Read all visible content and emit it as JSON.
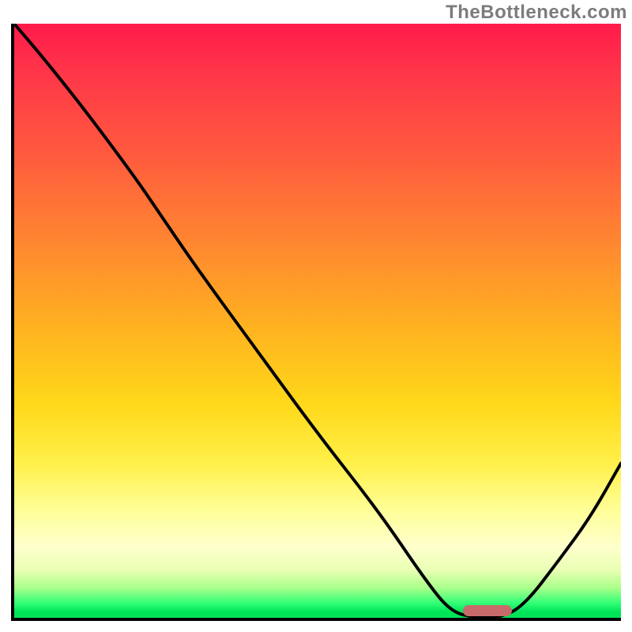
{
  "watermark": "TheBottleneck.com",
  "colors": {
    "gradient_top": "#ff1a4b",
    "gradient_mid1": "#ff8a2f",
    "gradient_mid2": "#ffd81a",
    "gradient_pale": "#ffffcc",
    "gradient_bottom": "#00e558",
    "curve": "#000000",
    "axis": "#000000",
    "marker": "#c96a6a",
    "watermark": "#7c7c7c"
  },
  "chart_data": {
    "type": "line",
    "title": "",
    "xlabel": "",
    "ylabel": "",
    "xlim": [
      0,
      100
    ],
    "ylim": [
      0,
      100
    ],
    "grid": false,
    "legend": false,
    "note": "Axes are unlabeled in the source image. X is an implicit parameter 0–100; Y is bottleneck percentage 0–100. Values are read from the curve shape.",
    "series": [
      {
        "name": "bottleneck-curve",
        "x": [
          0,
          5,
          12,
          20,
          24,
          30,
          40,
          50,
          60,
          68,
          72,
          76,
          80,
          84,
          90,
          95,
          100
        ],
        "y": [
          100,
          94,
          85,
          74,
          68,
          59,
          45,
          31,
          18,
          6,
          1,
          0,
          0,
          2,
          10,
          17,
          26
        ]
      }
    ],
    "minimum_marker": {
      "x_start": 74,
      "x_end": 82,
      "y": 0
    }
  }
}
